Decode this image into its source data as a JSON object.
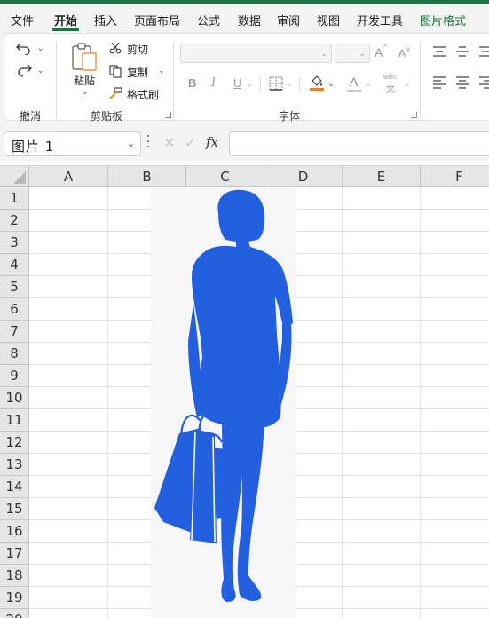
{
  "menu": {
    "tabs": [
      "文件",
      "开始",
      "插入",
      "页面布局",
      "公式",
      "数据",
      "审阅",
      "视图",
      "开发工具",
      "图片格式"
    ],
    "active_tab": "开始"
  },
  "ribbon": {
    "undo_group_label": "撤消",
    "clipboard_group_label": "剪贴板",
    "font_group_label": "字体",
    "paste_label": "粘贴",
    "cut_label": "剪切",
    "copy_label": "复制",
    "format_painter_label": "格式刷",
    "bold": "B",
    "italic": "I",
    "underline": "U",
    "font_color_letter": "A",
    "wen_label": "wén",
    "wen_char": "文",
    "font_grow": "A",
    "font_shrink": "A",
    "accent_color": "#1e7145",
    "highlight_color": "#e67e22"
  },
  "formula_bar": {
    "name_box": "图片 1",
    "fx": "fx",
    "formula": ""
  },
  "sheet": {
    "columns": [
      "A",
      "B",
      "C",
      "D",
      "E",
      "F"
    ],
    "rows": [
      "1",
      "2",
      "3",
      "4",
      "5",
      "6",
      "7",
      "8",
      "9",
      "10",
      "11",
      "12",
      "13",
      "14",
      "15",
      "16",
      "17",
      "18",
      "19",
      "20"
    ],
    "picture": {
      "subject": "woman-with-shopping-bags-silhouette",
      "fill_color": "#2360e0"
    }
  }
}
